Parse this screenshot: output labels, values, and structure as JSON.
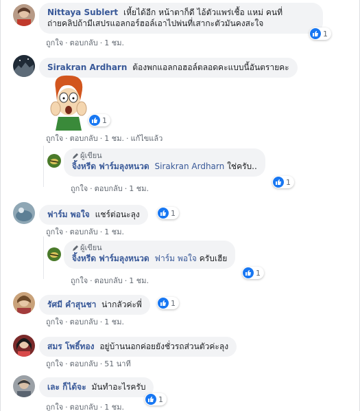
{
  "actions": {
    "like": "ถูกใจ",
    "reply": "ตอบกลับ",
    "edited": "แก้ไขแล้ว"
  },
  "author_label": "ผู้เขียน",
  "comments": [
    {
      "name": "Nittaya Sublert",
      "text1": "เหี้ยได้อีก หน้าตาก็ดี ไอ้ตัวแพร่เชื้อ แหม่ คนที่",
      "text2": "ถ่ายคลิปถ้ามีเสปรแอลกอร์ฮอล์เอาไปพ่นที่เสากะตัวมันคงสะใจ",
      "likes": "1",
      "time": "1 ชม."
    },
    {
      "name": "Sirakran Ardharn",
      "text": "ต้องพกแอลกอฮอล์ตลอดคะแบบนี้อันตรายคะ",
      "likes": "1",
      "time": "1 ชม."
    },
    {
      "reply_name": "จิ้งหรีด ฟาร์มลุงหนวด",
      "reply_tag": "Sirakran Ardharn",
      "reply_text": "ใช่ครับ..",
      "likes": "1",
      "time": "1 ชม."
    },
    {
      "name": "ฟาร์ม พอใจ",
      "text": "แชร์ต่อนะลุง",
      "likes": "1",
      "time": "1 ชม."
    },
    {
      "reply_name": "จิ้งหรีด ฟาร์มลุงหนวด",
      "reply_tag": "ฟาร์ม พอใจ",
      "reply_text": "ครับเฮีย",
      "likes": "1",
      "time": "1 ชม."
    },
    {
      "name": "รัศมี คำสุนชา",
      "text": "น่ากลัวค่ะพี่",
      "likes": "1",
      "time": "1 ชม."
    },
    {
      "name": "สมร โพธิ์ทอง",
      "text": "อยู่บ้านนอกค่อยยังชั่วรถส่วนตัวค่ะลุง",
      "likes": "",
      "time": "51 นาที"
    },
    {
      "name": "เละ ก็ได้จะ",
      "text": "มันทำอะไรครับ",
      "likes": "1",
      "time": "1 ชม."
    }
  ],
  "colors": {
    "name": "#385898",
    "bubble": "#f2f3f5",
    "meta": "#606770",
    "like": "#1877f2"
  }
}
